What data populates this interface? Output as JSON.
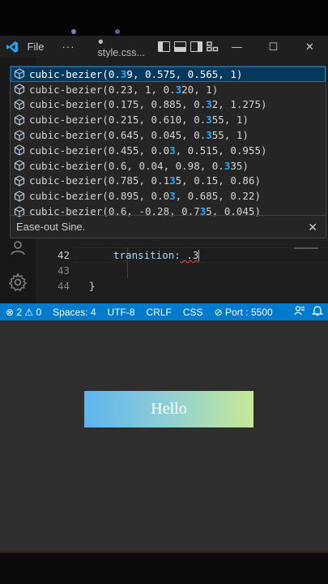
{
  "titlebar": {
    "menu_file": "File",
    "menu_more": "···",
    "tab_title": "● style.css...",
    "window_minimize": "—",
    "window_maximize": "☐",
    "window_close": "✕"
  },
  "suggestions": {
    "items": [
      {
        "pre": "cubic-bezier(0.",
        "hl": "3",
        "post": "9, 0.575, 0.565, 1)"
      },
      {
        "pre": "cubic-bezier(0.23, 1, 0.",
        "hl": "3",
        "post": "20, 1)"
      },
      {
        "pre": "cubic-bezier(0.175, 0.885, 0.",
        "hl": "3",
        "post": "2, 1.275)"
      },
      {
        "pre": "cubic-bezier(0.215, 0.610, 0.",
        "hl": "3",
        "post": "55, 1)"
      },
      {
        "pre": "cubic-bezier(0.645, 0.045, 0.",
        "hl": "3",
        "post": "55, 1)"
      },
      {
        "pre": "cubic-bezier(0.455, 0.0",
        "hl": "3",
        "post": ", 0.515, 0.955)"
      },
      {
        "pre": "cubic-bezier(0.6, 0.04, 0.98, 0.",
        "hl": "3",
        "post": "35)"
      },
      {
        "pre": "cubic-bezier(0.785, 0.1",
        "hl": "3",
        "post": "5, 0.15, 0.86)"
      },
      {
        "pre": "cubic-bezier(0.895, 0.0",
        "hl": "3",
        "post": ", 0.685, 0.22)"
      },
      {
        "pre": "cubic-bezier(0.6, -0.28, 0.7",
        "hl": "3",
        "post": "5, 0.045)"
      }
    ],
    "detail": "Ease-out Sine.",
    "close": "✕"
  },
  "editor": {
    "lines": [
      {
        "number": "42",
        "property": "transition:",
        "value": " .3"
      },
      {
        "number": "43"
      },
      {
        "number": "44",
        "brace": "}"
      }
    ]
  },
  "statusbar": {
    "problems": "⊗ 2 ⚠ 0",
    "spaces": "Spaces: 4",
    "encoding": "UTF-8",
    "eol": "CRLF",
    "language": "CSS",
    "port": "⊘ Port : 5500"
  },
  "preview": {
    "button_label": "Hello"
  },
  "colors": {
    "accent": "#007acc",
    "selected_suggestion": "#04395e",
    "match_highlight": "#2aaaff",
    "gradient_start": "#5fb4ef",
    "gradient_end": "#c7e895"
  }
}
